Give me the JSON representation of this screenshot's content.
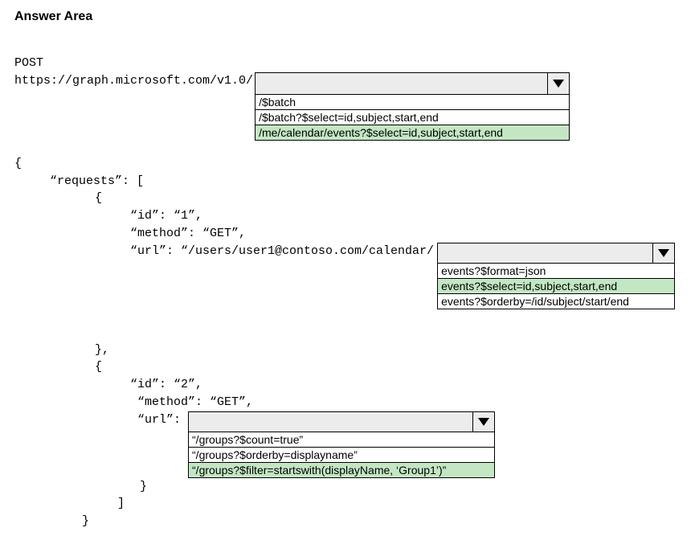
{
  "title": "Answer Area",
  "line_post": "POST",
  "line_url": "https://graph.microsoft.com/v1.0/",
  "dd1": {
    "value": "",
    "options": [
      {
        "text": "/$batch",
        "selected": false
      },
      {
        "text": "/$batch?$select=id,subject,start,end",
        "selected": false
      },
      {
        "text": "/me/calendar/events?$select=id,subject,start,end",
        "selected": true
      }
    ]
  },
  "code": {
    "brace_open": "{",
    "requests": "“requests”: [",
    "obj_open": "{",
    "id1": "“id”: “1”,",
    "method1": "“method”: “GET”,",
    "url1_pre": "“url”: “/users/user1@contoso.com/calendar/",
    "obj_close_comma": "},",
    "id2": "“id”: “2”,",
    "method2": " “method”: “GET”,",
    "url2_pre": " “url”: ",
    "obj_close": "}",
    "arr_close": "]",
    "brace_close": "}"
  },
  "dd2": {
    "value": "",
    "options": [
      {
        "text": "events?$format=json",
        "selected": false
      },
      {
        "text": "events?$select=id,subject,start,end",
        "selected": true
      },
      {
        "text": "events?$orderby=/id/subject/start/end",
        "selected": false
      }
    ]
  },
  "dd3": {
    "value": "",
    "options": [
      {
        "text": "“/groups?$count=true”",
        "selected": false
      },
      {
        "text": "“/groups?$orderby=displayname”",
        "selected": false
      },
      {
        "text": "“/groups?$filter=startswith(displayName, ‘Group1’)”",
        "selected": true
      }
    ]
  }
}
